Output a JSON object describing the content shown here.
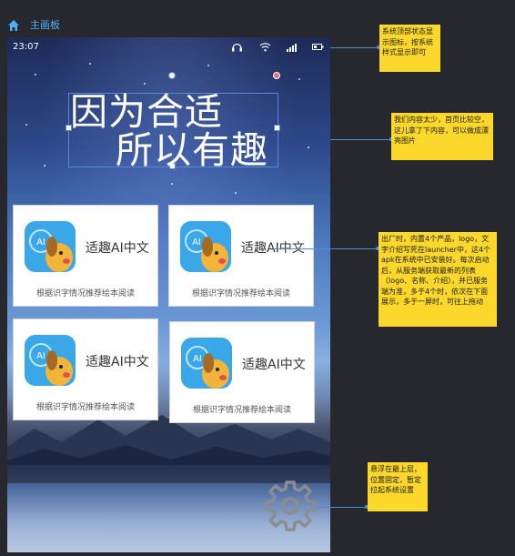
{
  "header": {
    "title": "主画板"
  },
  "phone": {
    "status_bar": {
      "time": "23:07"
    },
    "banner": {
      "line1": "因为合适",
      "line2": "所以有趣"
    },
    "products": [
      {
        "name": "适趣AI中文",
        "description": "根据识字情况推荐绘本阅读"
      },
      {
        "name": "适趣AI中文",
        "description": "根据识字情况推荐绘本阅读"
      },
      {
        "name": "适趣AI中文",
        "description": "根据识字情况推荐绘本阅读"
      },
      {
        "name": "适趣AI中文",
        "description": "根据识字情况推荐绘本阅读"
      }
    ],
    "logo_badge": "AI"
  },
  "annotations": [
    {
      "text": "系统顶部状态显示图标，按系统样式显示即可"
    },
    {
      "text": "我们内容太少，首页比较空，这儿拿了下内容，可以做成漂亮图片"
    },
    {
      "text": "出厂时，内置4个产品，logo，文字介绍写死在launcher中，这4个apk在系统中已安装好。每次启动后，从服务端获取最新的列表（logo、名称、介绍），并已服务端为准，多于4个时，依次在下面展示，多于一屏时，可往上拖动"
    },
    {
      "text": "悬浮在最上层，位置固定，暂定拉起系统设置"
    }
  ],
  "colors": {
    "accent": "#4fb0ff",
    "note_bg": "#fbd82b",
    "connector": "#4a90d9",
    "canvas_bg": "#27282d"
  },
  "icons": [
    "home-icon",
    "headset-icon",
    "wifi-icon",
    "signal-icon",
    "battery-icon",
    "gear-icon"
  ]
}
